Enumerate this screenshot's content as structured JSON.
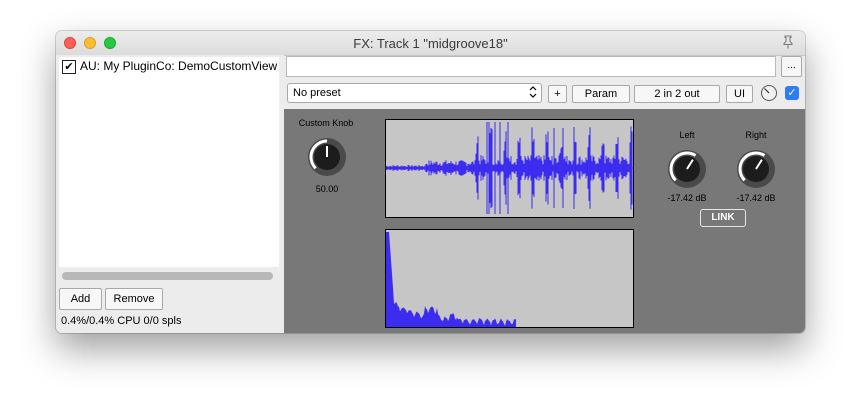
{
  "window": {
    "title": "FX: Track 1 \"midgroove18\"",
    "traffic_lights": {
      "close": "#ff5f57",
      "minimize": "#febc2e",
      "zoom": "#28c840"
    },
    "pin_icon": "pin-icon"
  },
  "fx_list": {
    "items": [
      {
        "label": "AU: My PluginCo: DemoCustomView",
        "checked": true
      }
    ],
    "add_label": "Add",
    "remove_label": "Remove",
    "cpu_text": "0.4%/0.4% CPU 0/0 spls"
  },
  "toolbar": {
    "more_label": "...",
    "preset_value": "No preset",
    "plus_label": "+",
    "param_label": "Param",
    "io_label": "2 in 2 out",
    "ui_label": "UI",
    "enabled": true
  },
  "plugin": {
    "custom_knob": {
      "label": "Custom Knob",
      "value_text": "50.00",
      "value": 0.5
    },
    "left": {
      "label": "Left",
      "value_text": "-17.42 dB",
      "value": 0.62
    },
    "right": {
      "label": "Right",
      "value_text": "-17.42 dB",
      "value": 0.62
    },
    "link_label": "LINK",
    "colors": {
      "background": "#787878",
      "display_bg": "#c6c6c6",
      "trace": "#3b2cf0"
    }
  }
}
